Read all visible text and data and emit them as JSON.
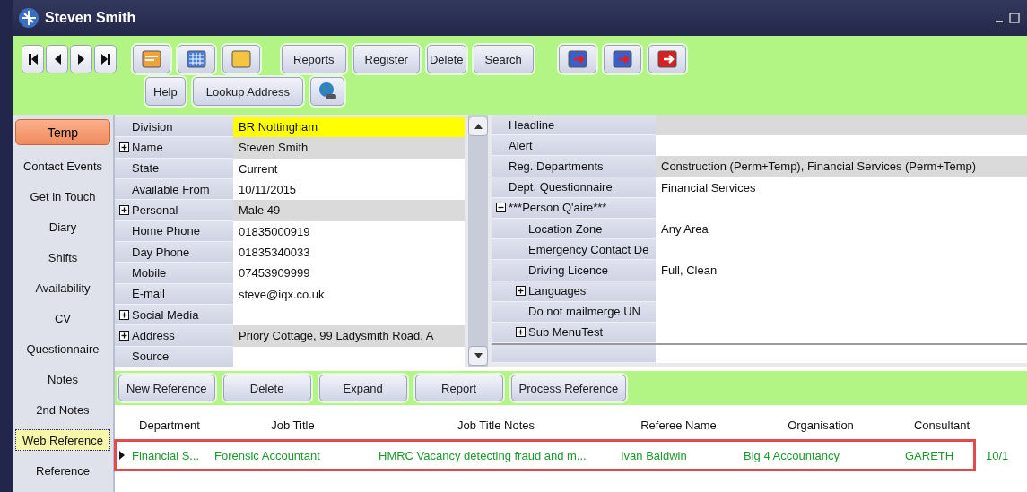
{
  "window": {
    "title": "Steven Smith"
  },
  "toolbar": {
    "row_1_buttons": [
      "Reports",
      "Register",
      "Delete",
      "Search"
    ],
    "row_2_buttons": [
      "Help",
      "Lookup Address"
    ]
  },
  "sidebar": {
    "status_button": "Temp",
    "items": [
      {
        "label": "Contact Events",
        "selected": false
      },
      {
        "label": "Get in Touch",
        "selected": false
      },
      {
        "label": "Diary",
        "selected": false
      },
      {
        "label": "Shifts",
        "selected": false
      },
      {
        "label": "Availability",
        "selected": false
      },
      {
        "label": "CV",
        "selected": false
      },
      {
        "label": "Questionnaire",
        "selected": false
      },
      {
        "label": "Notes",
        "selected": false
      },
      {
        "label": "2nd Notes",
        "selected": false
      },
      {
        "label": "Web Reference",
        "selected": true
      },
      {
        "label": "Reference",
        "selected": false
      }
    ]
  },
  "details": [
    {
      "label": "Division",
      "value": "BR Nottingham",
      "kind": "highlighted"
    },
    {
      "label": "Name",
      "value": "Steven Smith",
      "kind": "shaded",
      "expanded": false
    },
    {
      "label": "State",
      "value": "Current",
      "kind": "plain"
    },
    {
      "label": "Available From",
      "value": "10/11/2015",
      "kind": "plain"
    },
    {
      "label": "Personal",
      "value": "Male 49",
      "kind": "shaded",
      "expanded": false
    },
    {
      "label": "Home Phone",
      "value": "01835000919",
      "kind": "plain"
    },
    {
      "label": "Day Phone",
      "value": "01835340033",
      "kind": "plain"
    },
    {
      "label": "Mobile",
      "value": "07453909999",
      "kind": "plain"
    },
    {
      "label": "E-mail",
      "value": "steve@iqx.co.uk",
      "kind": "plain"
    },
    {
      "label": "Social Media",
      "kind": "plain",
      "expanded": false
    },
    {
      "label": "Address",
      "value": "Priory Cottage, 99 Ladysmith Road, A",
      "kind": "shaded",
      "expanded": false
    },
    {
      "label": "Source",
      "kind": "plain"
    }
  ],
  "properties": [
    {
      "label": "Headline",
      "kind": "shaded"
    },
    {
      "label": "Alert",
      "kind": "plain"
    },
    {
      "label": "Reg. Departments",
      "value": "Construction (Perm+Temp), Financial Services (Perm+Temp)",
      "kind": "shaded"
    },
    {
      "label": "Dept. Questionnaire",
      "value": "Financial Services",
      "kind": "plain"
    },
    {
      "label": "***Person Q'aire***",
      "kind": "plain",
      "expanded": true,
      "children": [
        {
          "label": "Location Zone",
          "value": "Any Area",
          "kind": "plain"
        },
        {
          "label": "Emergency Contact De",
          "kind": "plain"
        },
        {
          "label": "Driving Licence",
          "value": "Full, Clean",
          "kind": "plain"
        },
        {
          "label": "Languages",
          "kind": "plain",
          "expanded": false
        },
        {
          "label": "Do not mailmerge UN",
          "kind": "plain"
        },
        {
          "label": "Sub MenuTest",
          "kind": "plain",
          "expanded": false
        }
      ]
    }
  ],
  "reference_toolbar": {
    "buttons": [
      "New Reference",
      "Delete",
      "Expand",
      "Report",
      "Process Reference"
    ]
  },
  "table": {
    "columns": [
      "Department",
      "Job Title",
      "Job Title Notes",
      "Referee Name",
      "Organisation",
      "Consultant"
    ],
    "rows": [
      {
        "selected": true,
        "annotated": true,
        "cells": [
          "Financial S...",
          "Forensic Accountant",
          "HMRC Vacancy detecting fraud and m...",
          "Ivan Baldwin",
          "Blg 4 Accountancy",
          "GARETH",
          "10/1"
        ]
      }
    ]
  }
}
